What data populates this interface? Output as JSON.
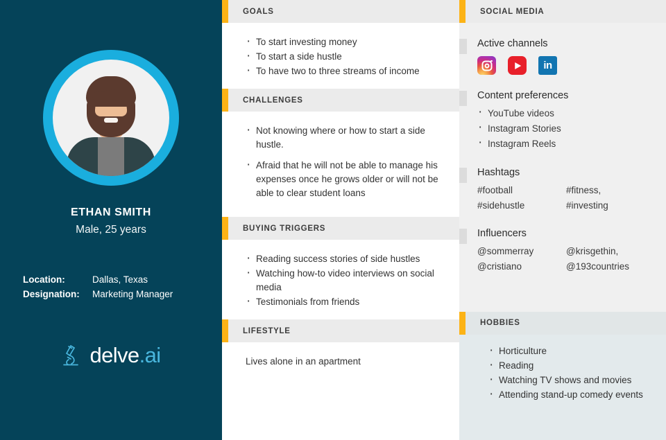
{
  "profile": {
    "name": "ETHAN SMITH",
    "subtitle": "Male, 25 years",
    "location_label": "Location:",
    "location_value": "Dallas, Texas",
    "designation_label": "Designation:",
    "designation_value": "Marketing Manager",
    "avatar_icon": "bearded-male-avatar-icon"
  },
  "brand": {
    "logo_icon": "microscope-icon",
    "name_primary": "delve",
    "name_suffix": ".ai"
  },
  "colors": {
    "panel_bg": "#054359",
    "accent_bar": "#fcb316",
    "avatar_ring": "#1aaede",
    "logo_accent": "#49b6dd",
    "section_head_bg": "#ebebeb",
    "right_col_bg": "#f0f0f0",
    "hobbies_bg": "#e3eaec",
    "instagram": "#cf2d7f",
    "youtube": "#e8202a",
    "linkedin": "#1275b1"
  },
  "middle": {
    "goals": {
      "title": "GOALS",
      "items": [
        "To start investing money",
        "To start a side hustle",
        "To have two to three streams of income"
      ]
    },
    "challenges": {
      "title": "CHALLENGES",
      "items": [
        "Not knowing where or how to start a side hustle.",
        "Afraid that he will not be able to manage his expenses once he grows older or will not be able to clear student loans"
      ]
    },
    "buying_triggers": {
      "title": "BUYING TRIGGERS",
      "items": [
        "Reading success stories of side hustles",
        "Watching how-to video interviews on social media",
        "Testimonials from friends"
      ]
    },
    "lifestyle": {
      "title": "LIFESTYLE",
      "text": "Lives alone in an apartment"
    }
  },
  "right": {
    "social_media": {
      "title": "SOCIAL MEDIA",
      "active_channels": {
        "title": "Active channels",
        "channels": [
          {
            "name": "Instagram",
            "icon": "instagram-icon"
          },
          {
            "name": "YouTube",
            "icon": "youtube-icon"
          },
          {
            "name": "LinkedIn",
            "icon": "linkedin-icon"
          }
        ]
      },
      "content_preferences": {
        "title": "Content preferences",
        "items": [
          "YouTube videos",
          "Instagram Stories",
          "Instagram Reels"
        ]
      },
      "hashtags": {
        "title": "Hashtags",
        "col1": [
          "#football",
          "#sidehustle"
        ],
        "col2": [
          "#fitness,",
          "#investing"
        ]
      },
      "influencers": {
        "title": "Influencers",
        "col1": [
          "@sommerray",
          "@cristiano"
        ],
        "col2": [
          "@krisgethin,",
          "@193countries"
        ]
      }
    },
    "hobbies": {
      "title": "HOBBIES",
      "items": [
        "Horticulture",
        "Reading",
        "Watching TV shows and movies",
        "Attending stand-up comedy events"
      ]
    }
  }
}
